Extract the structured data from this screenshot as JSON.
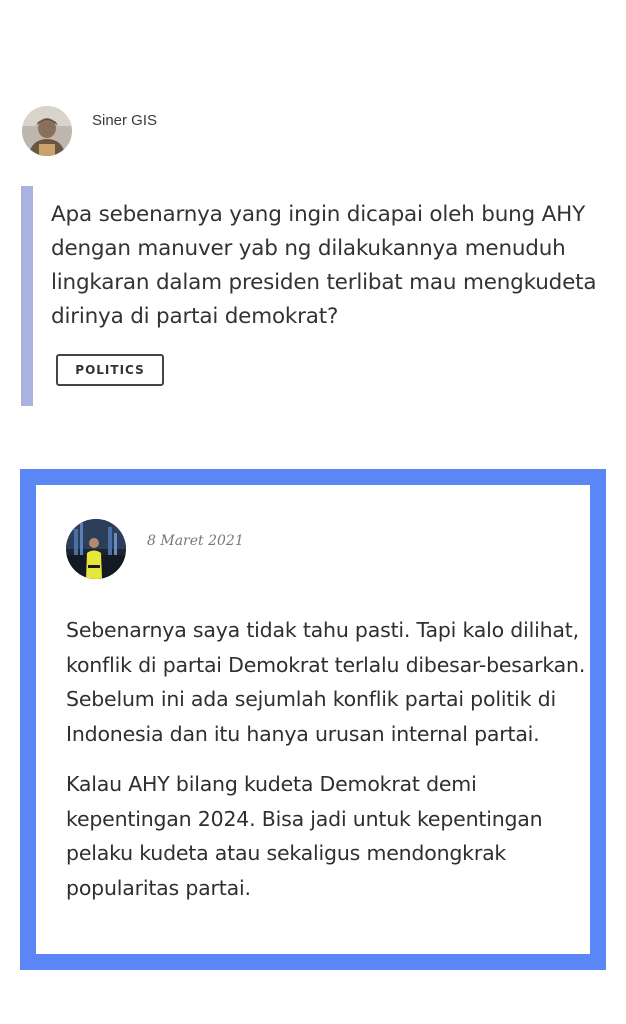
{
  "question": {
    "author": {
      "name": "Siner GIS"
    },
    "text": "Apa sebenarnya yang ingin dicapai oleh bung AHY dengan manuver yab ng dilakukannya menuduh lingkaran dalam presiden terlibat mau mengkudeta dirinya di partai demokrat?",
    "tag": "POLITICS",
    "accent_bar_color": "#aab3de"
  },
  "answer": {
    "date": "8 Maret 2021",
    "paragraphs": [
      "Sebenarnya saya tidak tahu pasti. Tapi kalo dilihat, konflik di partai Demokrat terlalu dibesar-besarkan. Sebelum ini ada sejumlah konflik partai politik di Indonesia dan itu hanya urusan internal partai.",
      "Kalau AHY bilang kudeta Demokrat demi kepentingan 2024. Bisa jadi untuk kepentingan pelaku kudeta atau sekaligus mendongkrak popularitas partai."
    ],
    "highlight_border_color": "#5b86f5"
  }
}
